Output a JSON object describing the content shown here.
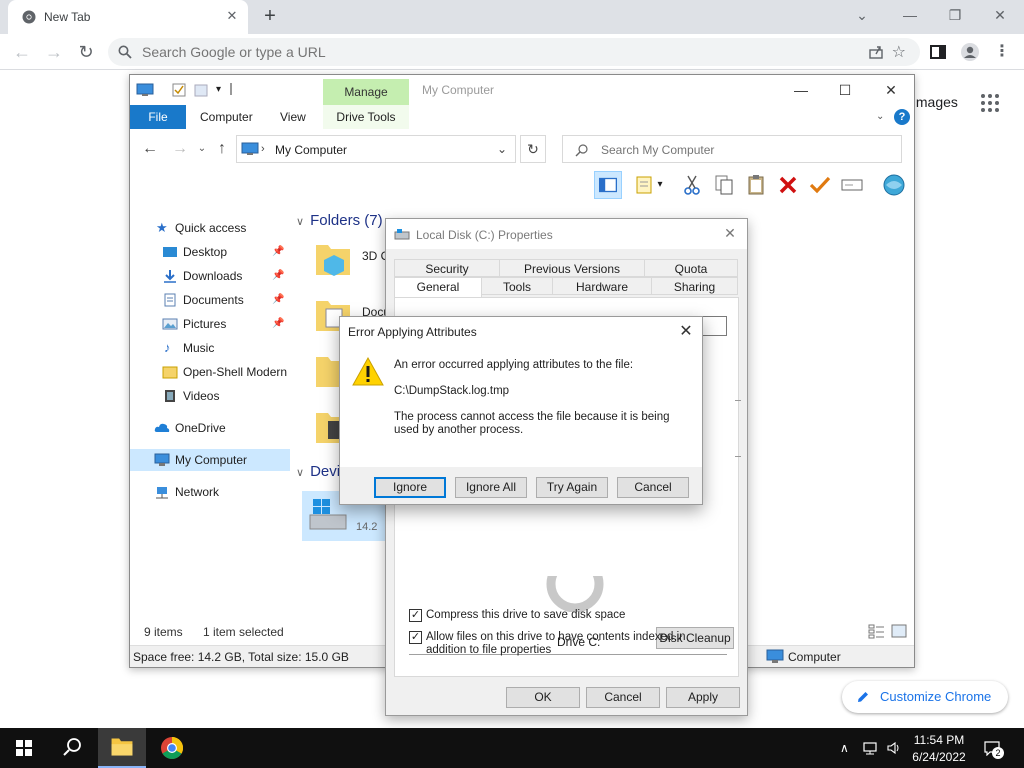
{
  "browser": {
    "tab_title": "New Tab",
    "omnibox_placeholder": "Search Google or type a URL",
    "images_link": "Images",
    "customize_label": "Customize Chrome"
  },
  "explorer": {
    "title": "My Computer",
    "manage_tab": "Manage",
    "ribbon_tabs": [
      "File",
      "Computer",
      "View",
      "Drive Tools"
    ],
    "address": "My Computer",
    "search_placeholder": "Search My Computer",
    "nav": {
      "quick_access": "Quick access",
      "desktop": "Desktop",
      "downloads": "Downloads",
      "documents": "Documents",
      "pictures": "Pictures",
      "music": "Music",
      "open_shell": "Open-Shell Modern",
      "videos": "Videos",
      "onedrive": "OneDrive",
      "my_computer": "My Computer",
      "network": "Network"
    },
    "folders_header": "Folders (7)",
    "devices_header": "Devi",
    "folder_3d": "3D O",
    "folder_docs": "Docu",
    "drive_size": "14.2",
    "status_items": "9 items",
    "status_selected": "1 item selected",
    "info_space": "Space free: 14.2 GB, Total size: 15.0 GB",
    "info_computer": "Computer"
  },
  "properties": {
    "title": "Local Disk (C:) Properties",
    "tabs_row1": [
      "Security",
      "Previous Versions",
      "Quota"
    ],
    "tabs_row2": [
      "General",
      "Tools",
      "Hardware",
      "Sharing"
    ],
    "drive_label": "Drive C:",
    "disk_cleanup": "Disk Cleanup",
    "compress_label": "Compress this drive to save disk space",
    "index_label": "Allow files on this drive to have contents indexed in addition to file properties",
    "ok": "OK",
    "cancel": "Cancel",
    "apply": "Apply"
  },
  "error": {
    "title": "Error Applying Attributes",
    "line1": "An error occurred applying attributes to the file:",
    "file": "C:\\DumpStack.log.tmp",
    "line2": "The process cannot access the file because it is being used by another process.",
    "ignore": "Ignore",
    "ignore_all": "Ignore All",
    "try_again": "Try Again",
    "cancel": "Cancel"
  },
  "taskbar": {
    "time": "11:54 PM",
    "date": "6/24/2022",
    "notifications": "2"
  },
  "colors": {
    "accent": "#1979ca",
    "manage_green": "#c5eeb0",
    "error_button_focus": "#0078d7"
  }
}
